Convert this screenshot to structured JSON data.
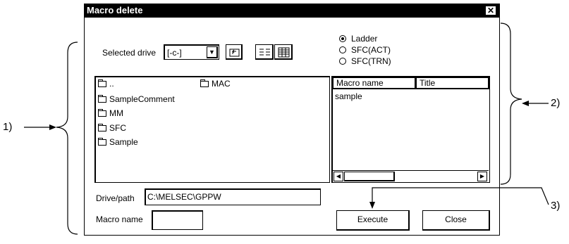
{
  "dialog": {
    "title": "Macro delete",
    "close_glyph": "✕"
  },
  "drive": {
    "label": "Selected drive",
    "value": "[-c-]"
  },
  "radios": [
    {
      "label": "Ladder",
      "selected": true
    },
    {
      "label": "SFC(ACT)",
      "selected": false
    },
    {
      "label": "SFC(TRN)",
      "selected": false
    }
  ],
  "folders": [
    {
      "name": ".."
    },
    {
      "name": "MAC"
    },
    {
      "name": "SampleComment"
    },
    {
      "name": "MM"
    },
    {
      "name": "SFC"
    },
    {
      "name": "Sample"
    }
  ],
  "macro_list": {
    "columns": [
      "Macro name",
      "Title"
    ],
    "rows": [
      [
        "sample",
        ""
      ]
    ]
  },
  "path": {
    "label": "Drive/path",
    "value": "C:\\MELSEC\\GPPW"
  },
  "macro_name": {
    "label": "Macro name",
    "value": ""
  },
  "buttons": {
    "execute": "Execute",
    "close": "Close"
  },
  "callouts": {
    "one": "1)",
    "two": "2)",
    "three": "3)"
  }
}
